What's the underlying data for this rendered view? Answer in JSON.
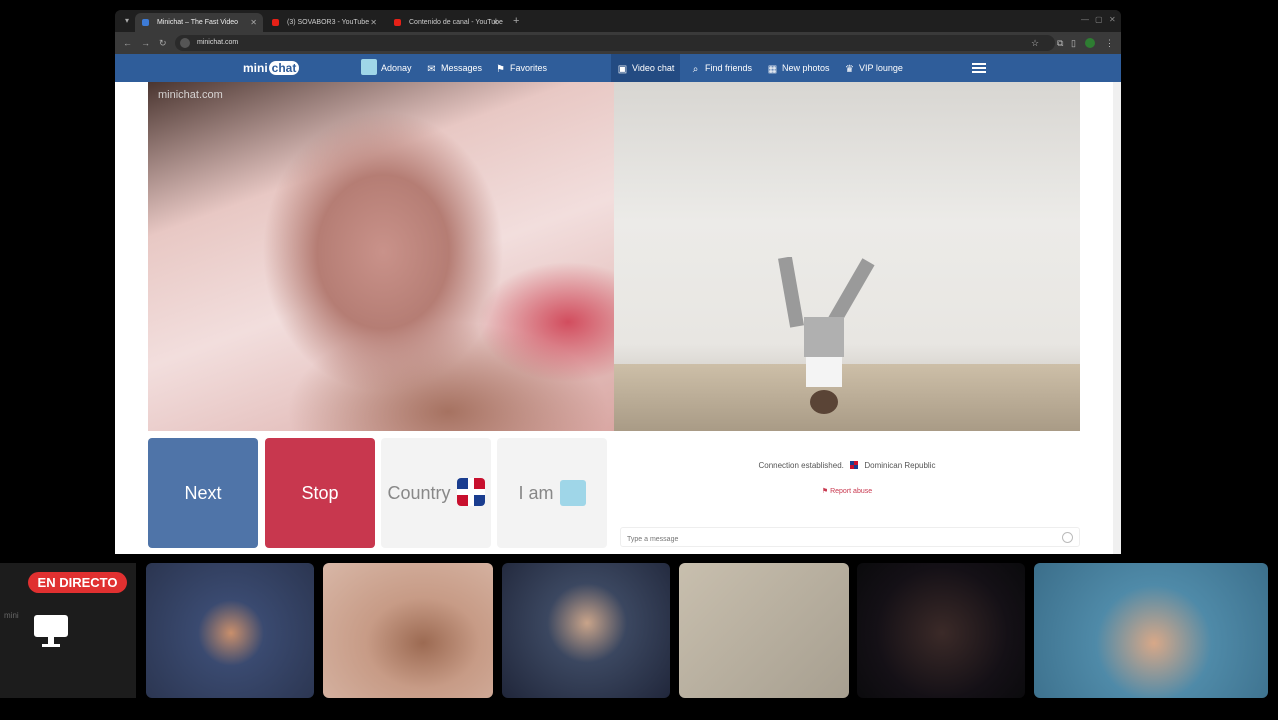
{
  "browser": {
    "tabs": [
      {
        "label": "Minichat – The Fast Video",
        "active": true,
        "favicon_color": "#3d7bd6"
      },
      {
        "label": "(3) SOVABOR3 - YouTube",
        "active": false,
        "favicon_color": "#e62117"
      },
      {
        "label": "Contenido de canal - YouTube",
        "active": false,
        "favicon_color": "#e62117"
      }
    ],
    "url": "minichat.com"
  },
  "site": {
    "logo_mini": "mini",
    "logo_chat": "chat",
    "nav": {
      "adonay": "Adonay",
      "messages": "Messages",
      "favorites": "Favorites",
      "video_chat": "Video chat",
      "find_friends": "Find friends",
      "new_photos": "New photos",
      "vip_lounge": "VIP lounge"
    },
    "watermark": "minichat.com",
    "buttons": {
      "next": "Next",
      "stop": "Stop",
      "country": "Country",
      "iam": "I am"
    },
    "status": {
      "connection": "Connection established.",
      "country": "Dominican Republic",
      "report": "Report abuse"
    },
    "message_placeholder": "Type a message"
  },
  "stream": {
    "live_badge": "EN DIRECTO",
    "left_thumb_text": "mini"
  },
  "colors": {
    "nav_blue": "#2f5d9a",
    "next_blue": "#4f74a8",
    "stop_red": "#c8374e",
    "live_red": "#e03030"
  }
}
